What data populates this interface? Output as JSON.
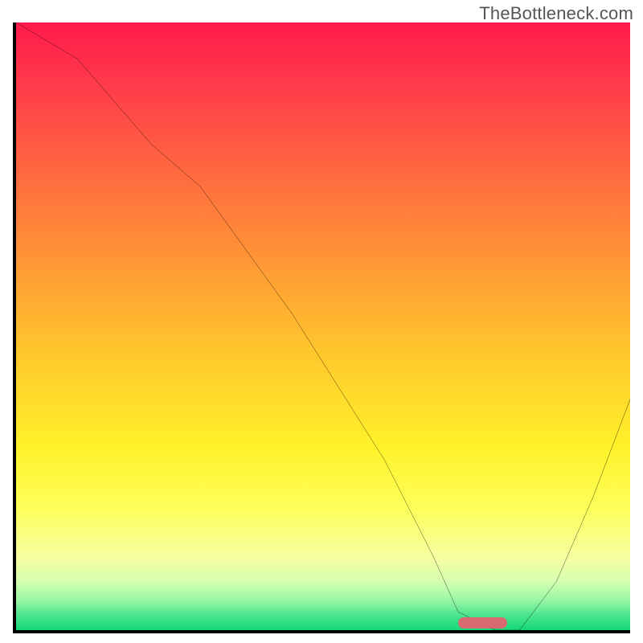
{
  "watermark": "TheBottleneck.com",
  "chart_data": {
    "type": "line",
    "title": "",
    "xlabel": "",
    "ylabel": "",
    "xlim": [
      0,
      100
    ],
    "ylim": [
      0,
      100
    ],
    "grid": false,
    "legend": false,
    "gradient_stops": [
      {
        "pct": 0,
        "color": "#ff1a4b"
      },
      {
        "pct": 10,
        "color": "#ff3a4a"
      },
      {
        "pct": 25,
        "color": "#ff6a3f"
      },
      {
        "pct": 40,
        "color": "#ff9935"
      },
      {
        "pct": 55,
        "color": "#ffc92c"
      },
      {
        "pct": 70,
        "color": "#fff22a"
      },
      {
        "pct": 80,
        "color": "#fdff5a"
      },
      {
        "pct": 88,
        "color": "#f6ffa0"
      },
      {
        "pct": 92,
        "color": "#d4ffb0"
      },
      {
        "pct": 95,
        "color": "#9bf7a6"
      },
      {
        "pct": 97.5,
        "color": "#4ee58e"
      },
      {
        "pct": 100,
        "color": "#13d977"
      }
    ],
    "series": [
      {
        "name": "bottleneck-curve",
        "x": [
          0,
          10,
          22,
          30,
          45,
          60,
          68,
          72,
          78,
          82,
          88,
          94,
          100
        ],
        "y": [
          100,
          94,
          80,
          73,
          52,
          28,
          12,
          3,
          0,
          0,
          8,
          22,
          38
        ]
      }
    ],
    "marker": {
      "x_start": 72,
      "x_end": 80,
      "y": 0
    }
  }
}
